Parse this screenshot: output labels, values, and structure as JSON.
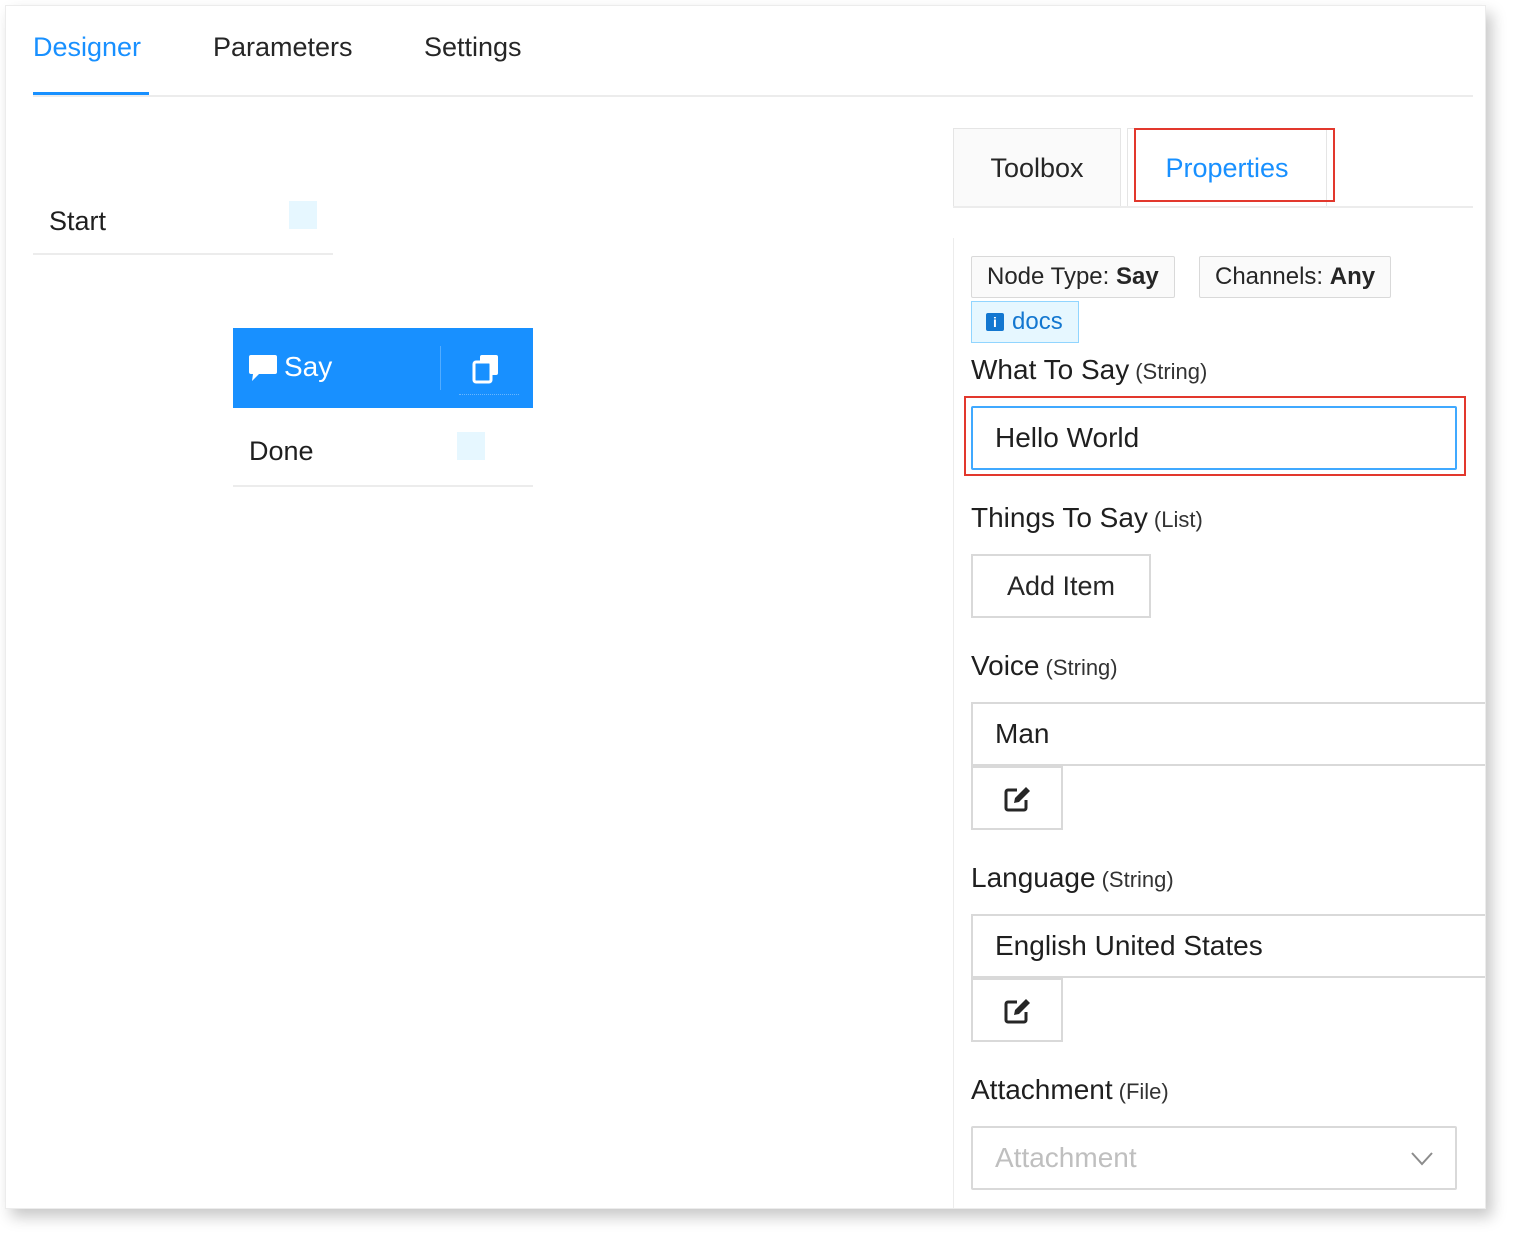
{
  "tabs": {
    "designer": "Designer",
    "parameters": "Parameters",
    "settings": "Settings"
  },
  "canvas": {
    "start_label": "Start",
    "say_label": "Say",
    "done_label": "Done"
  },
  "side_tabs": {
    "toolbox": "Toolbox",
    "properties": "Properties"
  },
  "properties": {
    "node_type_key": "Node Type:",
    "node_type_value": "Say",
    "channels_key": "Channels:",
    "channels_value": "Any",
    "docs_label": "docs",
    "docs_icon_glyph": "i",
    "what_to_say_label": "What To Say",
    "what_to_say_type": "(String)",
    "what_to_say_value": "Hello World",
    "things_to_say_label": "Things To Say",
    "things_to_say_type": "(List)",
    "add_item_label": "Add Item",
    "voice_label": "Voice",
    "voice_type": "(String)",
    "voice_value": "Man",
    "language_label": "Language",
    "language_type": "(String)",
    "language_value": "English United States",
    "attachment_label": "Attachment",
    "attachment_type": "(File)",
    "attachment_placeholder": "Attachment"
  },
  "icons": {
    "say": "speech-bubble-icon",
    "copy": "copy-icon",
    "edit": "edit-icon",
    "chevron": "chevron-down-icon"
  },
  "colors": {
    "accent": "#1890ff",
    "highlight": "#e2382d",
    "handle": "#e6f7ff"
  }
}
